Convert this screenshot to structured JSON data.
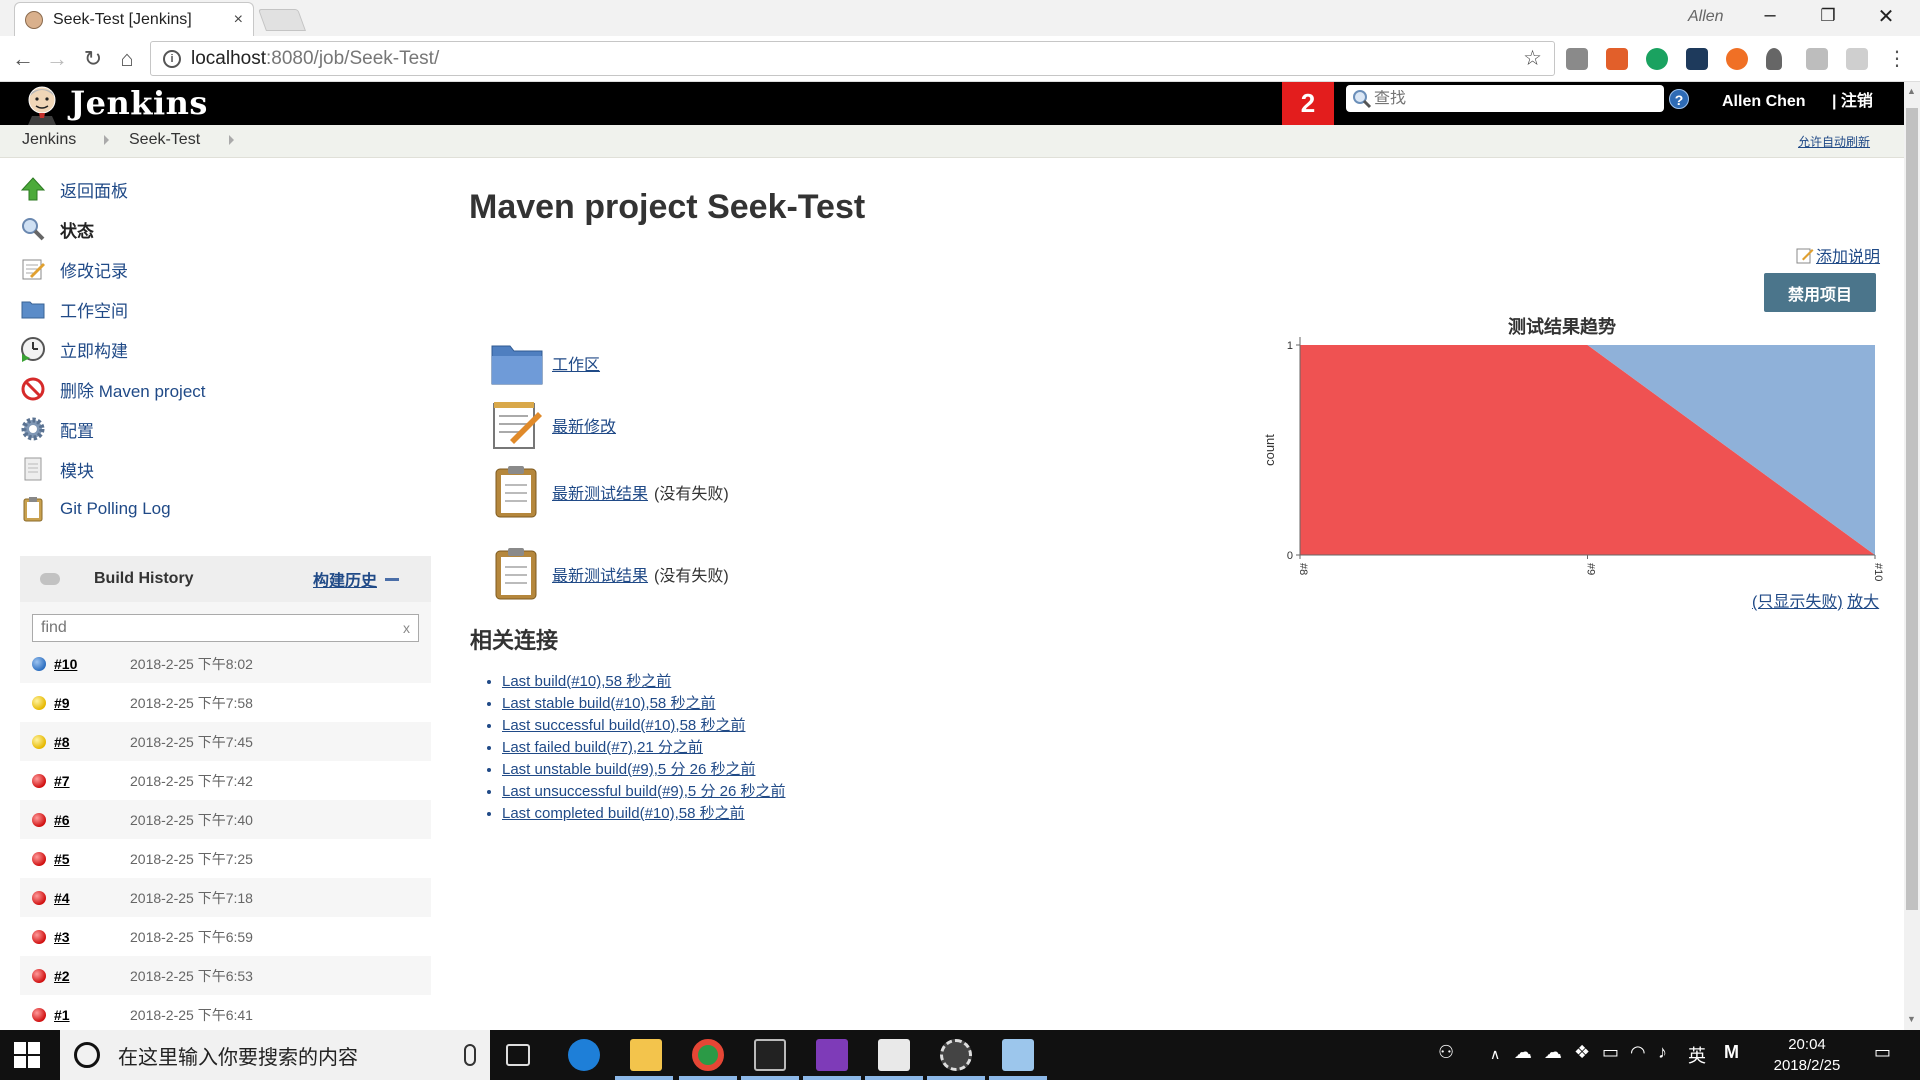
{
  "browser": {
    "tab_title": "Seek-Test [Jenkins]",
    "tab_close": "×",
    "window_user": "Allen",
    "url_host": "localhost",
    "url_rest": ":8080/job/Seek-Test/"
  },
  "header": {
    "brand": "Jenkins",
    "notifications": "2",
    "search_placeholder": "查找",
    "help": "?",
    "user": "Allen Chen",
    "logout": "| 注销"
  },
  "breadcrumb": {
    "items": [
      "Jenkins",
      "Seek-Test"
    ],
    "auto_refresh": "允许自动刷新"
  },
  "sidebar": {
    "items": [
      {
        "label": "返回面板",
        "icon": "up-arrow-icon"
      },
      {
        "label": "状态",
        "icon": "magnifier-icon"
      },
      {
        "label": "修改记录",
        "icon": "notepad-icon"
      },
      {
        "label": "工作空间",
        "icon": "folder-icon"
      },
      {
        "label": "立即构建",
        "icon": "build-clock-icon"
      },
      {
        "label": "删除 Maven project",
        "icon": "no-entry-icon"
      },
      {
        "label": "配置",
        "icon": "gear-icon"
      },
      {
        "label": "模块",
        "icon": "document-icon"
      },
      {
        "label": "Git Polling Log",
        "icon": "clipboard-icon"
      }
    ]
  },
  "build_history": {
    "title": "Build History",
    "trend_link": "构建历史",
    "filter_placeholder": "find",
    "filter_clear": "x",
    "builds": [
      {
        "num": "#10",
        "date": "2018-2-25 下午8:02",
        "status": "blue"
      },
      {
        "num": "#9",
        "date": "2018-2-25 下午7:58",
        "status": "yellow"
      },
      {
        "num": "#8",
        "date": "2018-2-25 下午7:45",
        "status": "yellow"
      },
      {
        "num": "#7",
        "date": "2018-2-25 下午7:42",
        "status": "red"
      },
      {
        "num": "#6",
        "date": "2018-2-25 下午7:40",
        "status": "red"
      },
      {
        "num": "#5",
        "date": "2018-2-25 下午7:25",
        "status": "red"
      },
      {
        "num": "#4",
        "date": "2018-2-25 下午7:18",
        "status": "red"
      },
      {
        "num": "#3",
        "date": "2018-2-25 下午6:59",
        "status": "red"
      },
      {
        "num": "#2",
        "date": "2018-2-25 下午6:53",
        "status": "red"
      },
      {
        "num": "#1",
        "date": "2018-2-25 下午6:41",
        "status": "red"
      }
    ]
  },
  "main": {
    "title": "Maven project Seek-Test",
    "add_description": "添加说明",
    "disable_button": "禁用项目",
    "permalinks": [
      {
        "label": "工作区",
        "note": "",
        "icon": "folder-big-icon"
      },
      {
        "label": "最新修改",
        "note": "",
        "icon": "notepad-big-icon"
      },
      {
        "label": "最新测试结果",
        "note": "(没有失败)",
        "icon": "clipboard-big-icon"
      },
      {
        "label": "最新测试结果",
        "note": "(没有失败)",
        "icon": "clipboard-big-icon"
      }
    ],
    "related_title": "相关连接",
    "related_links": [
      "Last build(#10),58 秒之前",
      "Last stable build(#10),58 秒之前",
      "Last successful build(#10),58 秒之前",
      "Last failed build(#7),21 分之前",
      "Last unstable build(#9),5 分 26 秒之前",
      "Last unsuccessful build(#9),5 分 26 秒之前",
      "Last completed build(#10),58 秒之前"
    ],
    "chart_links": {
      "failures_only": "(只显示失败)",
      "enlarge": "放大"
    }
  },
  "chart_data": {
    "type": "area",
    "title": "测试结果趋势",
    "ylabel": "count",
    "xlabel": "",
    "categories": [
      "#8",
      "#9",
      "#10"
    ],
    "ylim": [
      0,
      1
    ],
    "yticks": [
      "0",
      "1"
    ],
    "series": [
      {
        "values": [
          1,
          1,
          0
        ],
        "color": "#ef5252"
      },
      {
        "values": [
          0,
          0,
          1
        ],
        "color": "#8fb1d9"
      }
    ],
    "grid": false,
    "legend": "none"
  },
  "taskbar": {
    "search_text": "在这里输入你要搜索的内容",
    "ime": "英",
    "ime2": "M",
    "time": "20:04",
    "date": "2018/2/25"
  }
}
